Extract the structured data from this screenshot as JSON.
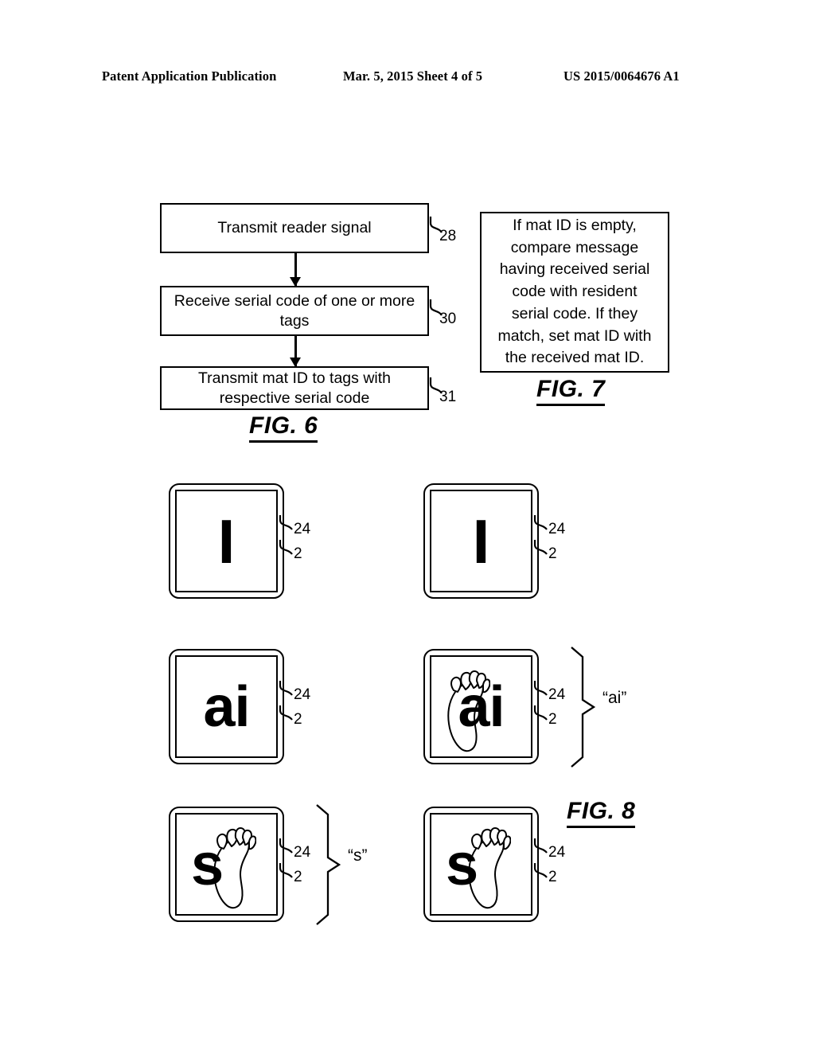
{
  "header": {
    "left": "Patent Application Publication",
    "middle": "Mar. 5, 2015  Sheet 4 of 5",
    "right": "US 2015/0064676 A1"
  },
  "fig6": {
    "caption": "FIG. 6",
    "steps": [
      {
        "text": "Transmit reader signal",
        "ref": "28"
      },
      {
        "text": "Receive serial code of one or more tags",
        "ref": "30"
      },
      {
        "text": "Transmit mat ID to tags with respective serial code",
        "ref": "31"
      }
    ]
  },
  "fig7": {
    "caption": "FIG. 7",
    "note": "If mat ID is empty, compare message having received serial code with resident serial code.  If they match, set mat ID with the received mat ID."
  },
  "fig8": {
    "caption": "FIG. 8",
    "ref_inner": "24",
    "ref_outer": "2",
    "tiles": [
      {
        "id": "tile-r1c1",
        "glyph": "I",
        "footprint": false,
        "bracket": null
      },
      {
        "id": "tile-r1c2",
        "glyph": "I",
        "footprint": false,
        "bracket": null
      },
      {
        "id": "tile-r2c1",
        "glyph": "ai",
        "footprint": false,
        "bracket": null
      },
      {
        "id": "tile-r2c2",
        "glyph": "ai",
        "footprint": true,
        "bracket": "“ai”"
      },
      {
        "id": "tile-r3c1",
        "glyph": "s",
        "footprint": true,
        "bracket": "“s”"
      },
      {
        "id": "tile-r3c2",
        "glyph": "s",
        "footprint": true,
        "bracket": null
      }
    ],
    "bracket_labels": {
      "ai": "“ai”",
      "s": "“s”"
    }
  },
  "colors": {
    "ink": "#000000",
    "paper": "#ffffff"
  }
}
